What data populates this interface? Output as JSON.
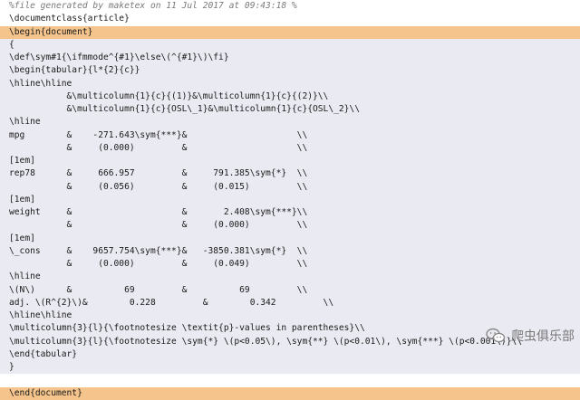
{
  "editor": {
    "lines": [
      {
        "text": "%file generated by maketex on 11 Jul 2017 at 09:43:18 %",
        "style": "comment",
        "bg": "none"
      },
      {
        "text": "\\documentclass{article}",
        "style": "code",
        "bg": "none"
      },
      {
        "text": "\\begin{document}",
        "style": "code",
        "bg": "header"
      },
      {
        "text": "{",
        "style": "code",
        "bg": "content"
      },
      {
        "text": "\\def\\sym#1{\\ifmmode^{#1}\\else\\(^{#1}\\)\\fi}",
        "style": "code",
        "bg": "content"
      },
      {
        "text": "\\begin{tabular}{l*{2}{c}}",
        "style": "code",
        "bg": "content"
      },
      {
        "text": "\\hline\\hline",
        "style": "code",
        "bg": "content"
      },
      {
        "text": "           &\\multicolumn{1}{c}{(1)}&\\multicolumn{1}{c}{(2)}\\\\",
        "style": "code",
        "bg": "content"
      },
      {
        "text": "           &\\multicolumn{1}{c}{OSL\\_1}&\\multicolumn{1}{c}{OSL\\_2}\\\\",
        "style": "code",
        "bg": "content"
      },
      {
        "text": "\\hline",
        "style": "code",
        "bg": "content"
      },
      {
        "text": "mpg        &    -271.643\\sym{***}&                     \\\\",
        "style": "code",
        "bg": "content"
      },
      {
        "text": "           &     (0.000)         &                     \\\\",
        "style": "code",
        "bg": "content"
      },
      {
        "text": "[1em]",
        "style": "code",
        "bg": "content"
      },
      {
        "text": "rep78      &     666.957         &     791.385\\sym{*}  \\\\",
        "style": "code",
        "bg": "content"
      },
      {
        "text": "           &     (0.056)         &     (0.015)         \\\\",
        "style": "code",
        "bg": "content"
      },
      {
        "text": "[1em]",
        "style": "code",
        "bg": "content"
      },
      {
        "text": "weight     &                     &       2.408\\sym{***}\\\\",
        "style": "code",
        "bg": "content"
      },
      {
        "text": "           &                     &     (0.000)         \\\\",
        "style": "code",
        "bg": "content"
      },
      {
        "text": "[1em]",
        "style": "code",
        "bg": "content"
      },
      {
        "text": "\\_cons     &    9657.754\\sym{***}&   -3850.381\\sym{*}  \\\\",
        "style": "code",
        "bg": "content"
      },
      {
        "text": "           &     (0.000)         &     (0.049)         \\\\",
        "style": "code",
        "bg": "content"
      },
      {
        "text": "\\hline",
        "style": "code",
        "bg": "content"
      },
      {
        "text": "\\(N\\)      &          69         &          69         \\\\",
        "style": "code",
        "bg": "content"
      },
      {
        "text": "adj. \\(R^{2}\\)&        0.228         &        0.342         \\\\",
        "style": "code",
        "bg": "content"
      },
      {
        "text": "\\hline\\hline",
        "style": "code",
        "bg": "content"
      },
      {
        "text": "\\multicolumn{3}{l}{\\footnotesize \\textit{p}-values in parentheses}\\\\",
        "style": "code",
        "bg": "content"
      },
      {
        "text": "\\multicolumn{3}{l}{\\footnotesize \\sym{*} \\(p<0.05\\), \\sym{**} \\(p<0.01\\), \\sym{***} \\(p<0.001\\)}\\\\",
        "style": "code",
        "bg": "content"
      },
      {
        "text": "\\end{tabular}",
        "style": "code",
        "bg": "content"
      },
      {
        "text": "}",
        "style": "code",
        "bg": "content"
      },
      {
        "text": "",
        "style": "code",
        "bg": "none"
      },
      {
        "text": "\\end{document}",
        "style": "code",
        "bg": "header"
      }
    ]
  },
  "watermark": {
    "text": "爬虫俱乐部",
    "icon": "wechat-icon"
  }
}
